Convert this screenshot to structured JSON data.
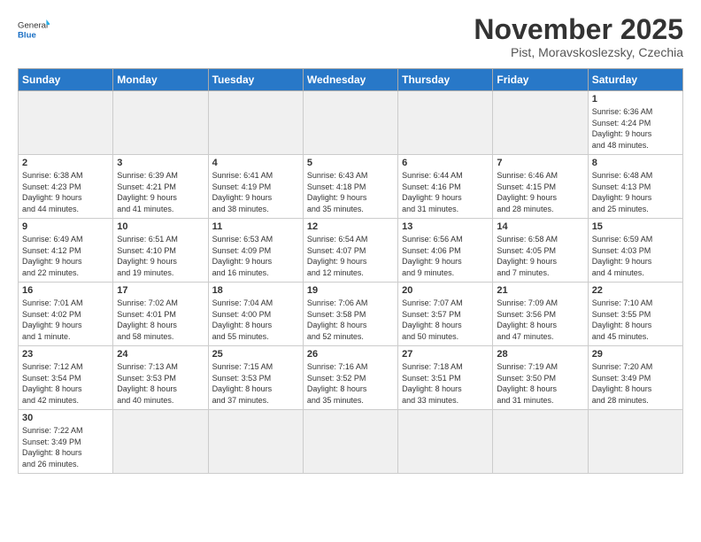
{
  "logo": {
    "general": "General",
    "blue": "Blue"
  },
  "header": {
    "month_year": "November 2025",
    "subtitle": "Pist, Moravskoslezsky, Czechia"
  },
  "weekdays": [
    "Sunday",
    "Monday",
    "Tuesday",
    "Wednesday",
    "Thursday",
    "Friday",
    "Saturday"
  ],
  "weeks": [
    [
      {
        "day": "",
        "info": "",
        "empty": true
      },
      {
        "day": "",
        "info": "",
        "empty": true
      },
      {
        "day": "",
        "info": "",
        "empty": true
      },
      {
        "day": "",
        "info": "",
        "empty": true
      },
      {
        "day": "",
        "info": "",
        "empty": true
      },
      {
        "day": "",
        "info": "",
        "empty": true
      },
      {
        "day": "1",
        "info": "Sunrise: 6:36 AM\nSunset: 4:24 PM\nDaylight: 9 hours\nand 48 minutes."
      }
    ],
    [
      {
        "day": "2",
        "info": "Sunrise: 6:38 AM\nSunset: 4:23 PM\nDaylight: 9 hours\nand 44 minutes."
      },
      {
        "day": "3",
        "info": "Sunrise: 6:39 AM\nSunset: 4:21 PM\nDaylight: 9 hours\nand 41 minutes."
      },
      {
        "day": "4",
        "info": "Sunrise: 6:41 AM\nSunset: 4:19 PM\nDaylight: 9 hours\nand 38 minutes."
      },
      {
        "day": "5",
        "info": "Sunrise: 6:43 AM\nSunset: 4:18 PM\nDaylight: 9 hours\nand 35 minutes."
      },
      {
        "day": "6",
        "info": "Sunrise: 6:44 AM\nSunset: 4:16 PM\nDaylight: 9 hours\nand 31 minutes."
      },
      {
        "day": "7",
        "info": "Sunrise: 6:46 AM\nSunset: 4:15 PM\nDaylight: 9 hours\nand 28 minutes."
      },
      {
        "day": "8",
        "info": "Sunrise: 6:48 AM\nSunset: 4:13 PM\nDaylight: 9 hours\nand 25 minutes."
      }
    ],
    [
      {
        "day": "9",
        "info": "Sunrise: 6:49 AM\nSunset: 4:12 PM\nDaylight: 9 hours\nand 22 minutes."
      },
      {
        "day": "10",
        "info": "Sunrise: 6:51 AM\nSunset: 4:10 PM\nDaylight: 9 hours\nand 19 minutes."
      },
      {
        "day": "11",
        "info": "Sunrise: 6:53 AM\nSunset: 4:09 PM\nDaylight: 9 hours\nand 16 minutes."
      },
      {
        "day": "12",
        "info": "Sunrise: 6:54 AM\nSunset: 4:07 PM\nDaylight: 9 hours\nand 12 minutes."
      },
      {
        "day": "13",
        "info": "Sunrise: 6:56 AM\nSunset: 4:06 PM\nDaylight: 9 hours\nand 9 minutes."
      },
      {
        "day": "14",
        "info": "Sunrise: 6:58 AM\nSunset: 4:05 PM\nDaylight: 9 hours\nand 7 minutes."
      },
      {
        "day": "15",
        "info": "Sunrise: 6:59 AM\nSunset: 4:03 PM\nDaylight: 9 hours\nand 4 minutes."
      }
    ],
    [
      {
        "day": "16",
        "info": "Sunrise: 7:01 AM\nSunset: 4:02 PM\nDaylight: 9 hours\nand 1 minute."
      },
      {
        "day": "17",
        "info": "Sunrise: 7:02 AM\nSunset: 4:01 PM\nDaylight: 8 hours\nand 58 minutes."
      },
      {
        "day": "18",
        "info": "Sunrise: 7:04 AM\nSunset: 4:00 PM\nDaylight: 8 hours\nand 55 minutes."
      },
      {
        "day": "19",
        "info": "Sunrise: 7:06 AM\nSunset: 3:58 PM\nDaylight: 8 hours\nand 52 minutes."
      },
      {
        "day": "20",
        "info": "Sunrise: 7:07 AM\nSunset: 3:57 PM\nDaylight: 8 hours\nand 50 minutes."
      },
      {
        "day": "21",
        "info": "Sunrise: 7:09 AM\nSunset: 3:56 PM\nDaylight: 8 hours\nand 47 minutes."
      },
      {
        "day": "22",
        "info": "Sunrise: 7:10 AM\nSunset: 3:55 PM\nDaylight: 8 hours\nand 45 minutes."
      }
    ],
    [
      {
        "day": "23",
        "info": "Sunrise: 7:12 AM\nSunset: 3:54 PM\nDaylight: 8 hours\nand 42 minutes."
      },
      {
        "day": "24",
        "info": "Sunrise: 7:13 AM\nSunset: 3:53 PM\nDaylight: 8 hours\nand 40 minutes."
      },
      {
        "day": "25",
        "info": "Sunrise: 7:15 AM\nSunset: 3:53 PM\nDaylight: 8 hours\nand 37 minutes."
      },
      {
        "day": "26",
        "info": "Sunrise: 7:16 AM\nSunset: 3:52 PM\nDaylight: 8 hours\nand 35 minutes."
      },
      {
        "day": "27",
        "info": "Sunrise: 7:18 AM\nSunset: 3:51 PM\nDaylight: 8 hours\nand 33 minutes."
      },
      {
        "day": "28",
        "info": "Sunrise: 7:19 AM\nSunset: 3:50 PM\nDaylight: 8 hours\nand 31 minutes."
      },
      {
        "day": "29",
        "info": "Sunrise: 7:20 AM\nSunset: 3:49 PM\nDaylight: 8 hours\nand 28 minutes."
      }
    ],
    [
      {
        "day": "30",
        "info": "Sunrise: 7:22 AM\nSunset: 3:49 PM\nDaylight: 8 hours\nand 26 minutes."
      },
      {
        "day": "",
        "info": "",
        "empty": true
      },
      {
        "day": "",
        "info": "",
        "empty": true
      },
      {
        "day": "",
        "info": "",
        "empty": true
      },
      {
        "day": "",
        "info": "",
        "empty": true
      },
      {
        "day": "",
        "info": "",
        "empty": true
      },
      {
        "day": "",
        "info": "",
        "empty": true
      }
    ]
  ]
}
